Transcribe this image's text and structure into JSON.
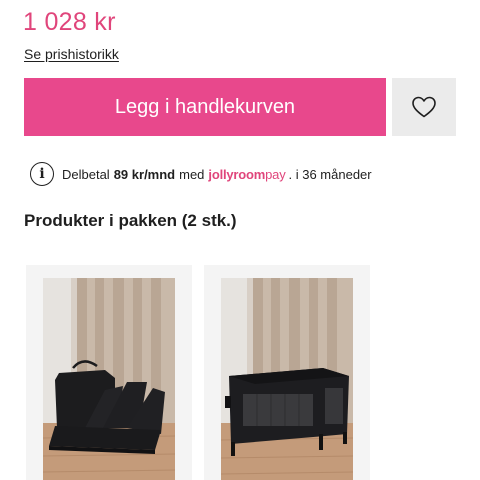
{
  "product": {
    "title_fragment": "",
    "price": "1 028 kr",
    "price_history_link": "Se prishistorikk"
  },
  "actions": {
    "add_to_cart": "Legg i handlekurven",
    "wishlist_icon": "heart-icon"
  },
  "payment": {
    "info_icon": "info-icon",
    "prefix": "Delbetal",
    "amount": "89 kr/mnd",
    "med": "med",
    "brand": "jollyroom",
    "brand_suffix": "pay",
    "suffix": ". i 36 måneder"
  },
  "package": {
    "title": "Produkter i pakken (2 stk.)",
    "items": [
      {
        "image": "folded-mattress-photo"
      },
      {
        "image": "travel-cot-photo"
      }
    ]
  },
  "colors": {
    "accent": "#e8488c",
    "price": "#e0457b",
    "wishlist_bg": "#ebebeb"
  }
}
